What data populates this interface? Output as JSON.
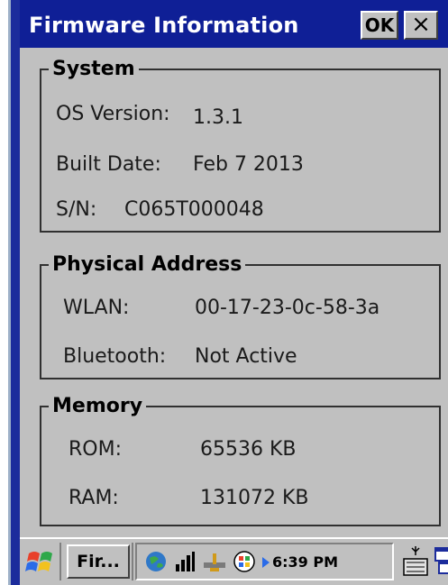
{
  "window": {
    "title": "Firmware Information",
    "ok_label": "OK",
    "close_label": "×"
  },
  "system": {
    "title": "System",
    "os_version_label": "OS Version:",
    "os_version_value": "1.3.1",
    "built_date_label": "Built Date:",
    "built_date_value": "Feb  7 2013",
    "sn_label": "S/N:",
    "sn_value": "C065T000048"
  },
  "physical_address": {
    "title": "Physical Address",
    "wlan_label": "WLAN:",
    "wlan_value": "00-17-23-0c-58-3a",
    "bluetooth_label": "Bluetooth:",
    "bluetooth_value": "Not Active"
  },
  "memory": {
    "title": "Memory",
    "rom_label": "ROM:",
    "rom_value": "65536 KB",
    "ram_label": "RAM:",
    "ram_value": "131072 KB"
  },
  "taskbar": {
    "task_label": "Fir...",
    "clock": "6:39 PM",
    "icons": [
      "windows-start-icon",
      "globe-icon",
      "signal-icon",
      "usb-icon",
      "network-icon",
      "keyboard-icon",
      "window-switch-icon"
    ]
  },
  "colors": {
    "titlebar": "#0f1f96",
    "background": "#c0c0c0"
  }
}
